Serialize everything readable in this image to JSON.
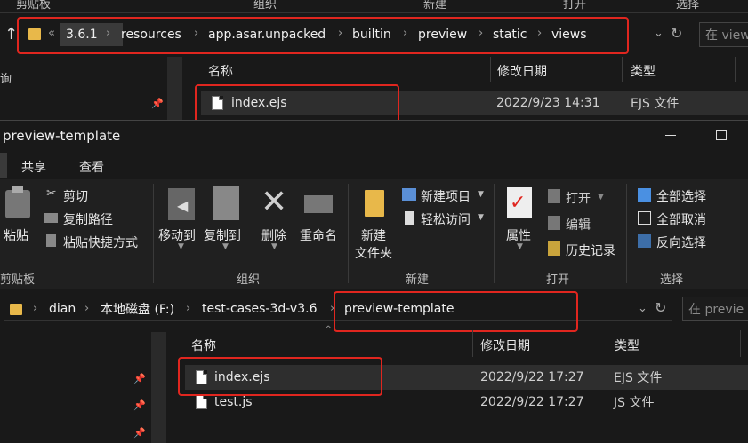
{
  "bg_window": {
    "group_labels": [
      "剪贴板",
      "组织",
      "新建",
      "打开",
      "选择"
    ],
    "breadcrumb": [
      "3.6.1",
      "resources",
      "app.asar.unpacked",
      "builtin",
      "preview",
      "static",
      "views"
    ],
    "overflow": "«",
    "search_placeholder": "在 view",
    "columns": {
      "name": "名称",
      "date": "修改日期",
      "type": "类型"
    },
    "files": [
      {
        "name": "index.ejs",
        "date": "2022/9/23 14:31",
        "type": "EJS 文件"
      }
    ],
    "left_char": "询"
  },
  "fg_window": {
    "title": "preview-template",
    "tabs": [
      "共享",
      "查看"
    ],
    "clipboard": {
      "paste": "粘贴",
      "cut": "剪切",
      "copy_path": "复制路径",
      "paste_shortcut": "粘贴快捷方式",
      "label": "剪贴板"
    },
    "organize": {
      "move_to": "移动到",
      "copy_to": "复制到",
      "delete": "删除",
      "rename": "重命名",
      "label": "组织"
    },
    "new": {
      "new_item": "新建项目",
      "easy_access": "轻松访问",
      "new_folder_line1": "新建",
      "new_folder_line2": "文件夹",
      "label": "新建"
    },
    "open": {
      "properties": "属性",
      "open": "打开",
      "edit": "编辑",
      "history": "历史记录",
      "label": "打开"
    },
    "select": {
      "select_all": "全部选择",
      "select_none": "全部取消",
      "invert": "反向选择",
      "label": "选择"
    },
    "breadcrumb": [
      "dian",
      "本地磁盘 (F:)",
      "test-cases-3d-v3.6",
      "preview-template"
    ],
    "search_placeholder": "在 previe",
    "columns": {
      "name": "名称",
      "date": "修改日期",
      "type": "类型"
    },
    "files": [
      {
        "name": "index.ejs",
        "date": "2022/9/22 17:27",
        "type": "EJS 文件"
      },
      {
        "name": "test.js",
        "date": "2022/9/22 17:27",
        "type": "JS 文件"
      }
    ]
  },
  "colors": {
    "highlight": "#e0261f",
    "folder": "#e8b84a",
    "background": "#191919"
  }
}
